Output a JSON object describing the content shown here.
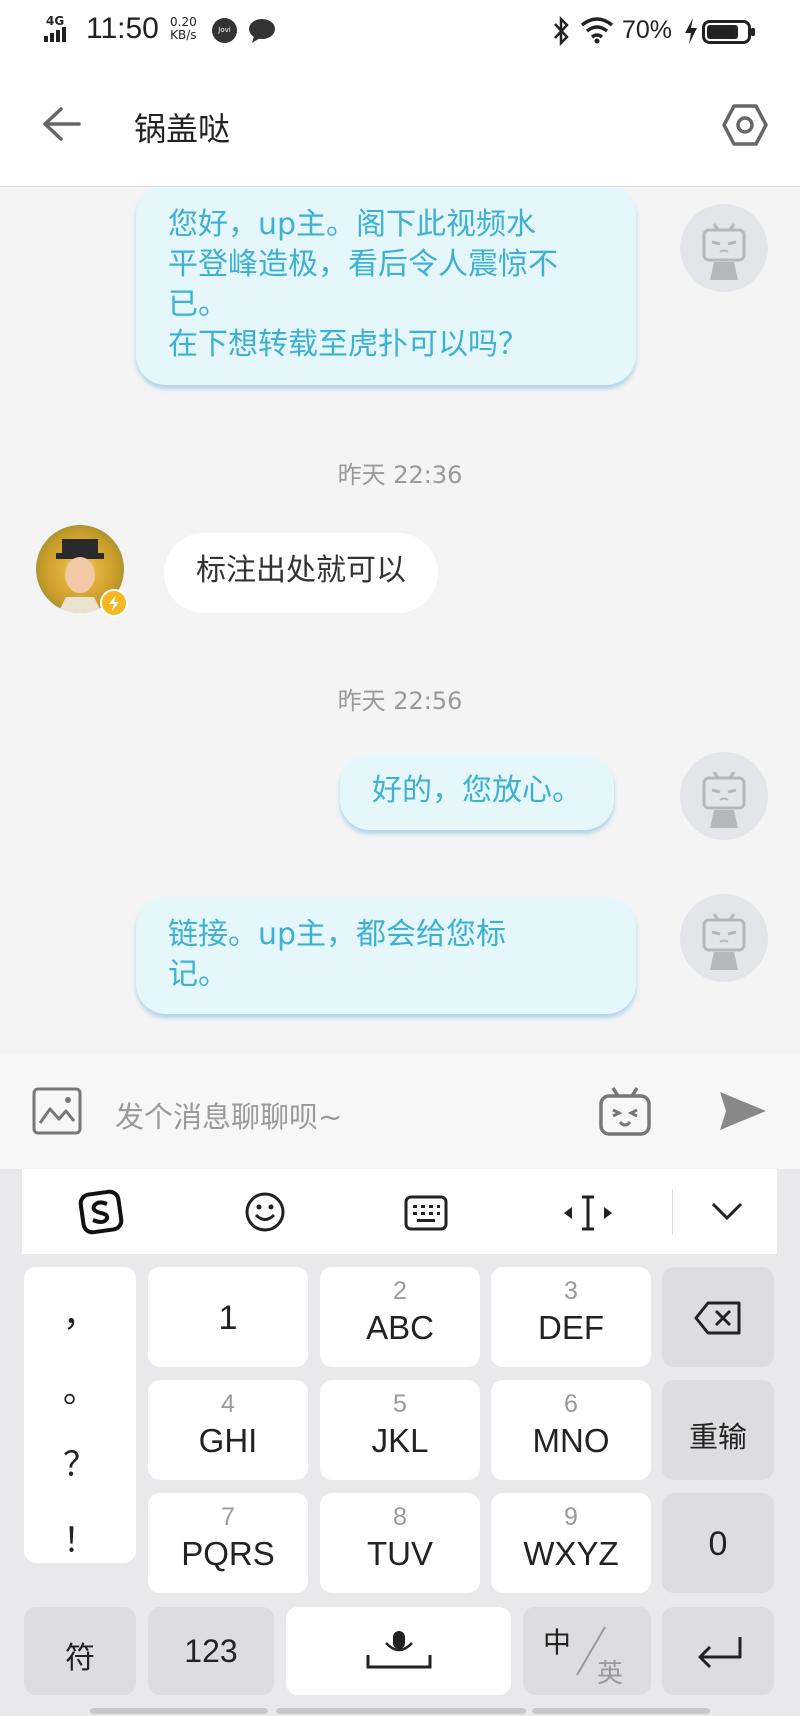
{
  "status_bar": {
    "network": "4G",
    "time": "11:50",
    "speed_value": "0.20",
    "speed_unit": "KB/s",
    "jovi_badge": "Jovi",
    "battery_percent": "70%",
    "icons": [
      "signal-icon",
      "jovi-icon",
      "message-icon",
      "bluetooth-icon",
      "wifi-icon",
      "charging-icon",
      "battery-icon"
    ]
  },
  "header": {
    "title": "锅盖哒",
    "back_icon": "arrow-left-icon",
    "settings_icon": "hexagon-settings-icon"
  },
  "chat": {
    "messages": [
      {
        "side": "out",
        "text": "您好，up主。阁下此视频水\n平登峰造极，看后令人震惊不\n已。\n在下想转载至虎扑可以吗？"
      },
      {
        "timestamp": "昨天 22:36"
      },
      {
        "side": "in",
        "text": "标注出处就可以"
      },
      {
        "timestamp": "昨天 22:56"
      },
      {
        "side": "out",
        "text": "好的，您放心。"
      },
      {
        "side": "out",
        "text": "链接。up主，都会给您标\n记。"
      }
    ]
  },
  "composer": {
    "placeholder": "发个消息聊聊呗~",
    "icons": [
      "image-icon",
      "emoji-tv-icon",
      "send-icon"
    ]
  },
  "keyboard": {
    "toolbar_icons": [
      "sogou-logo-icon",
      "smiley-icon",
      "keyboard-icon",
      "cursor-move-icon",
      "chevron-down-icon"
    ],
    "punctuation": [
      "，",
      "。",
      "？",
      "！"
    ],
    "keys_row1": [
      {
        "num": "",
        "letters": "1"
      },
      {
        "num": "2",
        "letters": "ABC"
      },
      {
        "num": "3",
        "letters": "DEF"
      }
    ],
    "keys_row2": [
      {
        "num": "4",
        "letters": "GHI"
      },
      {
        "num": "5",
        "letters": "JKL"
      },
      {
        "num": "6",
        "letters": "MNO"
      }
    ],
    "keys_row3": [
      {
        "num": "7",
        "letters": "PQRS"
      },
      {
        "num": "8",
        "letters": "TUV"
      },
      {
        "num": "9",
        "letters": "WXYZ"
      }
    ],
    "right_keys": {
      "backspace_icon": "backspace-icon",
      "retype": "重输",
      "zero": "0"
    },
    "bottom_row": {
      "symbols": "符",
      "numbers": "123",
      "mic_icon": "microphone-space-icon",
      "lang_cn": "中",
      "lang_en": "英",
      "enter_icon": "enter-icon"
    }
  }
}
